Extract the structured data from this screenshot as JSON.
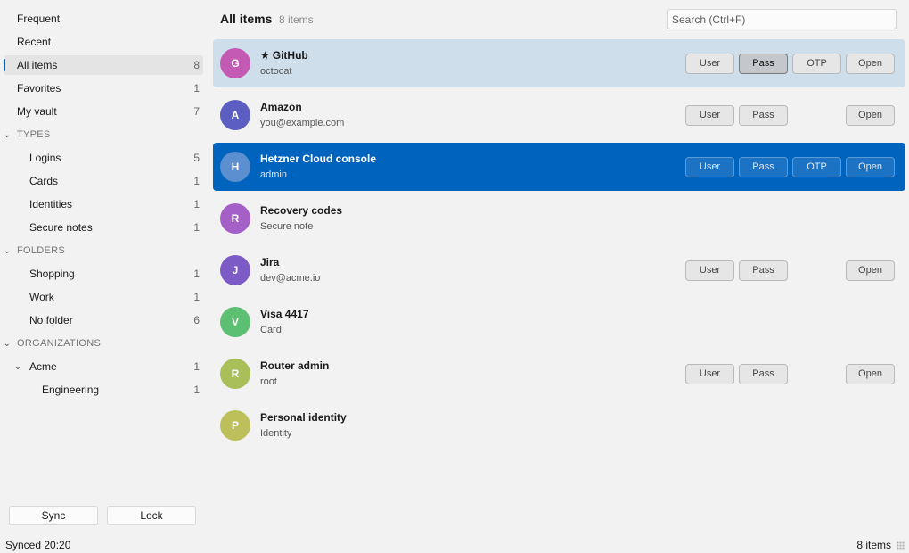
{
  "sidebar": {
    "top": [
      {
        "label": "Frequent",
        "count": ""
      },
      {
        "label": "Recent",
        "count": ""
      },
      {
        "label": "All items",
        "count": "8"
      },
      {
        "label": "Favorites",
        "count": "1"
      },
      {
        "label": "My vault",
        "count": "7"
      }
    ],
    "types": {
      "header": "TYPES",
      "items": [
        {
          "label": "Logins",
          "count": "5"
        },
        {
          "label": "Cards",
          "count": "1"
        },
        {
          "label": "Identities",
          "count": "1"
        },
        {
          "label": "Secure notes",
          "count": "1"
        }
      ]
    },
    "folders": {
      "header": "FOLDERS",
      "items": [
        {
          "label": "Shopping",
          "count": "1"
        },
        {
          "label": "Work",
          "count": "1"
        },
        {
          "label": "No folder",
          "count": "6"
        }
      ]
    },
    "organizations": {
      "header": "ORGANIZATIONS",
      "org": {
        "label": "Acme",
        "count": "1"
      },
      "collection": {
        "label": "Engineering",
        "count": "1"
      }
    },
    "chevron_glyph": "⌄",
    "sync_label": "Sync",
    "lock_label": "Lock"
  },
  "main": {
    "title": "All items",
    "count_text": "8 items",
    "search_placeholder": "Search (Ctrl+F)",
    "action_labels": {
      "user": "User",
      "pass": "Pass",
      "otp": "OTP",
      "open": "Open"
    },
    "items": [
      {
        "initial": "G",
        "name": "GitHub",
        "favorite_glyph": "★",
        "sub": "octocat",
        "avatar_color": "#c45ab3"
      },
      {
        "initial": "A",
        "name": "Amazon",
        "sub": "you@example.com",
        "avatar_color": "#5c5fc1"
      },
      {
        "initial": "H",
        "name": "Hetzner Cloud console",
        "sub": "admin",
        "avatar_color": "#5b8fcf"
      },
      {
        "initial": "R",
        "name": "Recovery codes",
        "sub": "Secure note",
        "avatar_color": "#a560c8"
      },
      {
        "initial": "J",
        "name": "Jira",
        "sub": "dev@acme.io",
        "avatar_color": "#7d5bc7"
      },
      {
        "initial": "V",
        "name": "Visa 4417",
        "sub": "Card",
        "avatar_color": "#5cbf72"
      },
      {
        "initial": "R",
        "name": "Router admin",
        "sub": "root",
        "avatar_color": "#a9bf5a"
      },
      {
        "initial": "P",
        "name": "Personal identity",
        "sub": "Identity",
        "avatar_color": "#bcbf5a"
      }
    ]
  },
  "statusbar": {
    "left": "Synced 20:20",
    "right": "8 items"
  },
  "colors": {
    "accent": "#005fb8",
    "selected_row": "#0063bd",
    "hover_row": "#cfdeeb"
  }
}
